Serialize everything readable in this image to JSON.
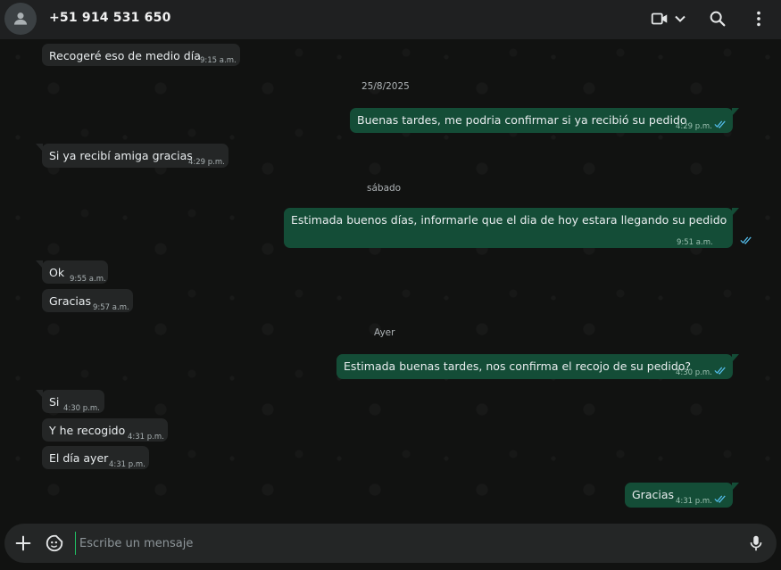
{
  "header": {
    "contact_name": "+51 914 531 650",
    "icons": [
      "avatar-icon",
      "video-call-icon",
      "chevron-down-icon",
      "search-icon",
      "menu-dots-icon"
    ]
  },
  "chat": {
    "dates": {
      "d1": "25/8/2025",
      "d2": "sábado",
      "d3": "Ayer"
    },
    "messages": [
      {
        "dir": "in",
        "text": "Recogeré eso de medio día",
        "time": "9:15 a.m."
      },
      {
        "dir": "out",
        "text": "Buenas tardes, me podria confirmar si ya recibió  su pedido",
        "time": "4:29 p.m."
      },
      {
        "dir": "in",
        "text": "Si ya recibí amiga gracias",
        "time": "4:29 p.m."
      },
      {
        "dir": "out",
        "text": "Estimada buenos días, informarle que el dia de hoy estara llegando su pedido",
        "time": "9:51 a.m."
      },
      {
        "dir": "in",
        "text": "Ok",
        "time": "9:55 a.m."
      },
      {
        "dir": "in",
        "text": "Gracias",
        "time": "9:57 a.m."
      },
      {
        "dir": "out",
        "text": "Estimada buenas tardes, nos confirma el recojo de su pedido?",
        "time": "4:30 p.m."
      },
      {
        "dir": "in",
        "text": "Si",
        "time": "4:30 p.m."
      },
      {
        "dir": "in",
        "text": "Y he recogido",
        "time": "4:31 p.m."
      },
      {
        "dir": "in",
        "text": "El día ayer",
        "time": "4:31 p.m."
      },
      {
        "dir": "out",
        "text": "Gracias",
        "time": "4:31 p.m."
      }
    ]
  },
  "composer": {
    "placeholder": "Escribe un mensaje",
    "icons": [
      "plus-icon",
      "sticker-icon",
      "microphone-icon"
    ]
  },
  "colors": {
    "outgoing_bubble": "#144d37",
    "incoming_bubble": "#242626",
    "read_ticks": "#53bdeb",
    "cursor_accent": "#21c063"
  }
}
